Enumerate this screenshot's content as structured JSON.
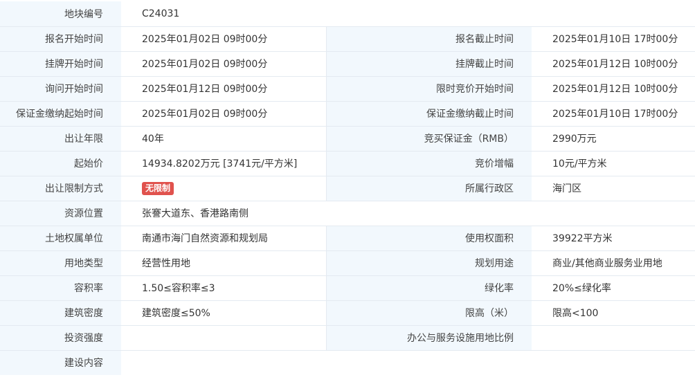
{
  "land_info": {
    "plot_number": {
      "label": "地块编号",
      "value": "C24031"
    },
    "rows": [
      {
        "left": {
          "label": "报名开始时间",
          "value": "2025年01月02日 09时00分"
        },
        "right": {
          "label": "报名截止时间",
          "value": "2025年01月10日 17时00分"
        }
      },
      {
        "left": {
          "label": "挂牌开始时间",
          "value": "2025年01月02日 09时00分"
        },
        "right": {
          "label": "挂牌截止时间",
          "value": "2025年01月12日 10时00分"
        }
      },
      {
        "left": {
          "label": "询问开始时间",
          "value": "2025年01月12日 09时00分"
        },
        "right": {
          "label": "限时竞价开始时间",
          "value": "2025年01月12日 10时00分"
        }
      },
      {
        "left": {
          "label": "保证金缴纳起始时间",
          "value": "2025年01月02日 09时00分"
        },
        "right": {
          "label": "保证金缴纳截止时间",
          "value": "2025年01月10日 17时00分"
        }
      },
      {
        "left": {
          "label": "出让年限",
          "value": "40年"
        },
        "right": {
          "label": "竞买保证金（RMB）",
          "value": "2990万元"
        }
      },
      {
        "left": {
          "label": "起始价",
          "value": "14934.8202万元 [3741元/平方米]"
        },
        "right": {
          "label": "竞价增幅",
          "value": "10元/平方米"
        }
      }
    ],
    "restriction": {
      "label": "出让限制方式",
      "badge": "无限制",
      "badge_color": "#e0524d",
      "right": {
        "label": "所属行政区",
        "value": "海门区"
      }
    },
    "location": {
      "label": "资源位置",
      "value": "张謇大道东、香港路南侧"
    },
    "rows2": [
      {
        "left": {
          "label": "土地权属单位",
          "value": "南通市海门自然资源和规划局"
        },
        "right": {
          "label": "使用权面积",
          "value": "39922平方米"
        }
      },
      {
        "left": {
          "label": "用地类型",
          "value": "经营性用地"
        },
        "right": {
          "label": "规划用途",
          "value": "商业/其他商业服务业用地"
        }
      },
      {
        "left": {
          "label": "容积率",
          "value": "1.50≤容积率≤3"
        },
        "right": {
          "label": "绿化率",
          "value": "20%≤绿化率"
        }
      },
      {
        "left": {
          "label": "建筑密度",
          "value": "建筑密度≤50%"
        },
        "right": {
          "label": "限高（米）",
          "value": "限高<100"
        }
      },
      {
        "left": {
          "label": "投资强度",
          "value": ""
        },
        "right": {
          "label": "办公与服务设施用地比例",
          "value": ""
        }
      }
    ],
    "construction": {
      "label": "建设内容",
      "value": ""
    }
  },
  "colors": {
    "label_bg": "#f2f8fd",
    "border": "#e4eaf1",
    "badge": "#e0524d"
  }
}
